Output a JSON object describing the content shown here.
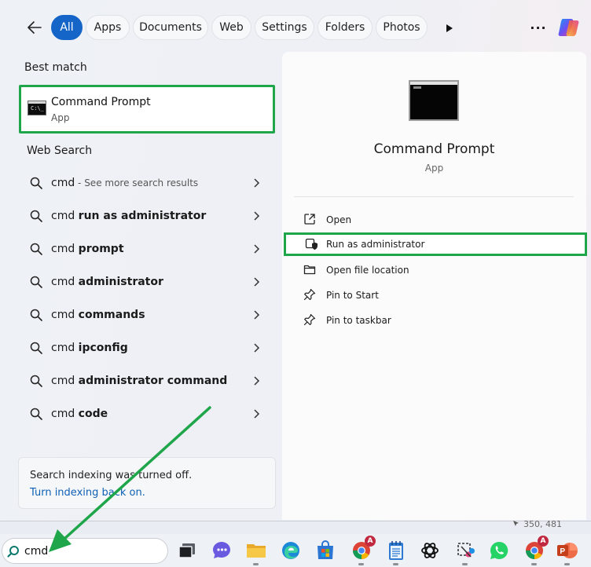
{
  "filters": {
    "tabs": [
      {
        "label": "All"
      },
      {
        "label": "Apps"
      },
      {
        "label": "Documents"
      },
      {
        "label": "Web"
      },
      {
        "label": "Settings"
      },
      {
        "label": "Folders"
      },
      {
        "label": "Photos"
      }
    ],
    "more": "···"
  },
  "left": {
    "best_match_heading": "Best match",
    "best_match": {
      "title": "Command Prompt",
      "subtitle": "App"
    },
    "web_search_heading": "Web Search",
    "results": [
      {
        "prefix": "cmd",
        "bold": "",
        "note": " - See more search results"
      },
      {
        "prefix": "cmd ",
        "bold": "run as administrator",
        "note": ""
      },
      {
        "prefix": "cmd ",
        "bold": "prompt",
        "note": ""
      },
      {
        "prefix": "cmd ",
        "bold": "administrator",
        "note": ""
      },
      {
        "prefix": "cmd ",
        "bold": "commands",
        "note": ""
      },
      {
        "prefix": "cmd ",
        "bold": "ipconfig",
        "note": ""
      },
      {
        "prefix": "cmd ",
        "bold": "administrator command",
        "note": ""
      },
      {
        "prefix": "cmd ",
        "bold": "code",
        "note": ""
      }
    ],
    "indexing": {
      "message": "Search indexing was turned off.",
      "link": "Turn indexing back on."
    }
  },
  "right": {
    "app_title": "Command Prompt",
    "app_subtitle": "App",
    "actions": [
      {
        "label": "Open",
        "icon": "open-icon"
      },
      {
        "label": "Run as administrator",
        "icon": "shield-icon"
      },
      {
        "label": "Open file location",
        "icon": "folder-icon"
      },
      {
        "label": "Pin to Start",
        "icon": "pin-icon"
      },
      {
        "label": "Pin to taskbar",
        "icon": "pin-icon"
      }
    ]
  },
  "coord_readout": "350, 481",
  "taskbar": {
    "search_value": "cmd",
    "badges": {
      "chrome_1": "A",
      "chrome_2": "A"
    }
  },
  "colors": {
    "accent": "#1565c8",
    "highlight_box": "#1fa64a",
    "annotation_arrow": "#1fa64a",
    "link": "#0f60b6"
  }
}
